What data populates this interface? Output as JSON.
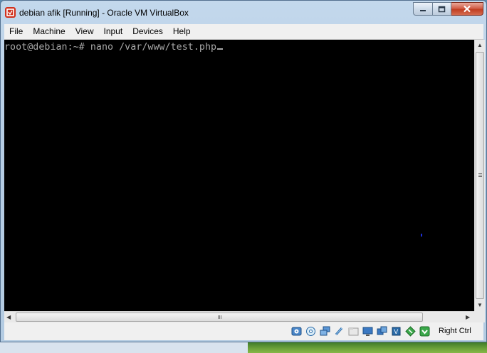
{
  "window": {
    "title": "debian afik [Running] - Oracle VM VirtualBox",
    "app_icon": "virtualbox-icon"
  },
  "menu": {
    "items": [
      {
        "label": "File"
      },
      {
        "label": "Machine"
      },
      {
        "label": "View"
      },
      {
        "label": "Input"
      },
      {
        "label": "Devices"
      },
      {
        "label": "Help"
      }
    ]
  },
  "console": {
    "prompt": "root@debian:~# ",
    "command": "nano /var/www/test.php",
    "text_color": "#a8a8a8",
    "background": "#000000"
  },
  "statusbar": {
    "icons": [
      "hard-disk-icon",
      "optical-disc-icon",
      "network-icon",
      "usb-icon",
      "shared-folders-icon",
      "display-icon",
      "video-capture-icon",
      "cpu-virtualization-icon",
      "mouse-integration-icon",
      "keyboard-capture-icon"
    ],
    "host_key": "Right Ctrl"
  }
}
